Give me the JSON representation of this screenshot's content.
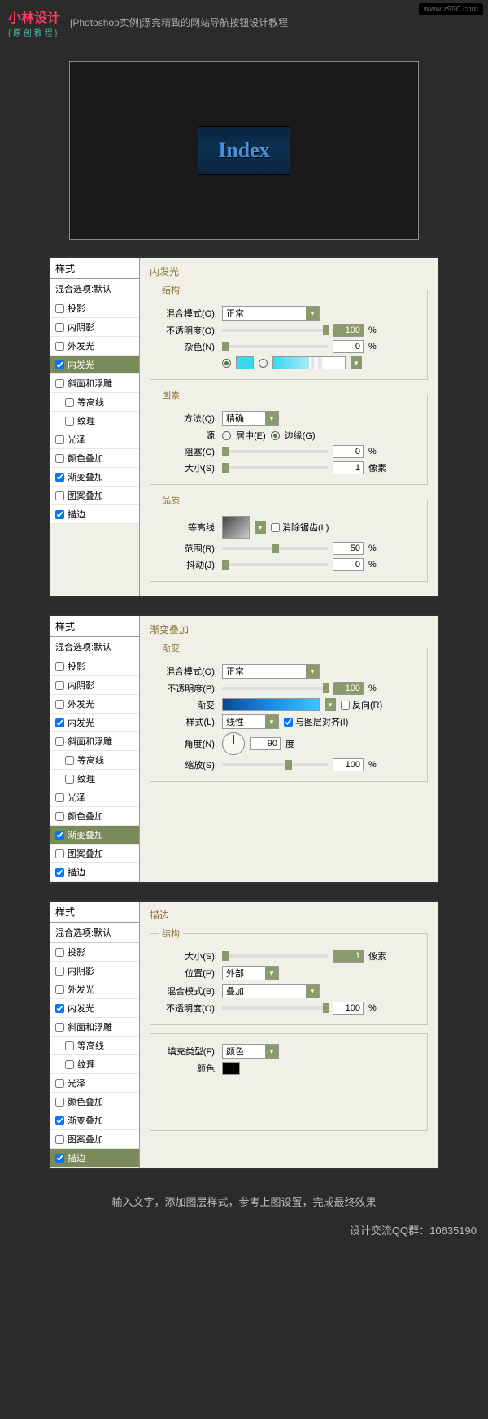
{
  "header": {
    "logo_main": "小林设计",
    "logo_sub": "{ 原 创 教 程 }",
    "title": "[Photoshop实例]漂亮精致的网站导航按钮设计教程",
    "watermark": "www.z990.com"
  },
  "preview": {
    "button_text": "Index"
  },
  "styles_panel": {
    "header": "样式",
    "sub": "混合选项:默认",
    "items": [
      {
        "label": "投影",
        "checked": false,
        "indent": false
      },
      {
        "label": "内阴影",
        "checked": false,
        "indent": false
      },
      {
        "label": "外发光",
        "checked": false,
        "indent": false
      },
      {
        "label": "内发光",
        "checked": true,
        "indent": false
      },
      {
        "label": "斜面和浮雕",
        "checked": false,
        "indent": false
      },
      {
        "label": "等高线",
        "checked": false,
        "indent": true
      },
      {
        "label": "纹理",
        "checked": false,
        "indent": true
      },
      {
        "label": "光泽",
        "checked": false,
        "indent": false
      },
      {
        "label": "颜色叠加",
        "checked": false,
        "indent": false
      },
      {
        "label": "渐变叠加",
        "checked": true,
        "indent": false
      },
      {
        "label": "图案叠加",
        "checked": false,
        "indent": false
      },
      {
        "label": "描边",
        "checked": true,
        "indent": false
      }
    ]
  },
  "panel1": {
    "title": "内发光",
    "group_structure": "结构",
    "blend_mode_label": "混合模式(O):",
    "blend_mode": "正常",
    "opacity_label": "不透明度(O):",
    "opacity": "100",
    "opacity_unit": "%",
    "noise_label": "杂色(N):",
    "noise": "0",
    "noise_unit": "%",
    "group_elements": "图素",
    "technique_label": "方法(Q):",
    "technique": "精确",
    "source_label": "源:",
    "source_center": "居中(E)",
    "source_edge": "边缘(G)",
    "choke_label": "阻塞(C):",
    "choke": "0",
    "choke_unit": "%",
    "size_label": "大小(S):",
    "size": "1",
    "size_unit": "像素",
    "group_quality": "品质",
    "contour_label": "等高线:",
    "antialias": "消除锯齿(L)",
    "range_label": "范围(R):",
    "range": "50",
    "range_unit": "%",
    "jitter_label": "抖动(J):",
    "jitter": "0",
    "jitter_unit": "%"
  },
  "panel2": {
    "title": "渐变叠加",
    "group": "渐变",
    "blend_mode_label": "混合模式(O):",
    "blend_mode": "正常",
    "opacity_label": "不透明度(P):",
    "opacity": "100",
    "opacity_unit": "%",
    "gradient_label": "渐变:",
    "reverse": "反向(R)",
    "style_label": "样式(L):",
    "style": "线性",
    "align": "与图层对齐(I)",
    "angle_label": "角度(N):",
    "angle": "90",
    "angle_unit": "度",
    "scale_label": "缩放(S):",
    "scale": "100",
    "scale_unit": "%"
  },
  "panel3": {
    "title": "描边",
    "group_structure": "结构",
    "size_label": "大小(S):",
    "size": "1",
    "size_unit": "像素",
    "position_label": "位置(P):",
    "position": "外部",
    "blend_mode_label": "混合模式(B):",
    "blend_mode": "叠加",
    "opacity_label": "不透明度(O):",
    "opacity": "100",
    "opacity_unit": "%",
    "fill_type_label": "填充类型(F):",
    "fill_type": "颜色",
    "color_label": "颜色:"
  },
  "footer": {
    "text": "输入文字，添加图层样式，参考上图设置，完成最终效果",
    "qq": "设计交流QQ群：10635190"
  }
}
